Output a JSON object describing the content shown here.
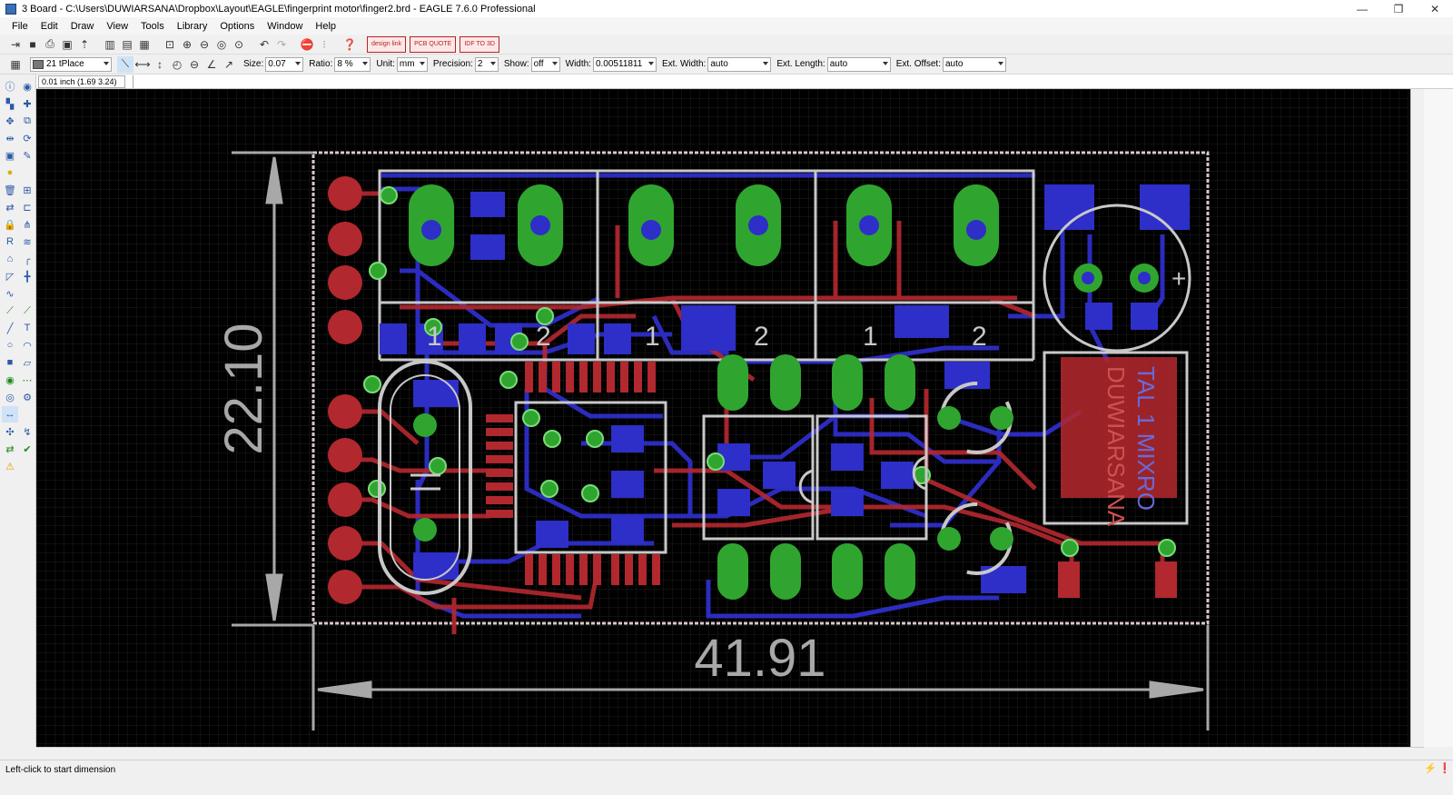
{
  "window": {
    "title": "3 Board - C:\\Users\\DUWIARSANA\\Dropbox\\Layout\\EAGLE\\fingerprint motor\\finger2.brd - EAGLE 7.6.0 Professional",
    "minimize": "—",
    "maximize": "❐",
    "close": "✕"
  },
  "menu": [
    "File",
    "Edit",
    "Draw",
    "View",
    "Tools",
    "Library",
    "Options",
    "Window",
    "Help"
  ],
  "promo": {
    "design_link": "design link",
    "pcb_quote": "PCB QUOTE",
    "idf": "IDF TO 3D"
  },
  "params": {
    "layer": "21 tPlace",
    "size_label": "Size:",
    "size": "0.07",
    "ratio_label": "Ratio:",
    "ratio": "8 %",
    "unit_label": "Unit:",
    "unit": "mm",
    "precision_label": "Precision:",
    "precision": "2",
    "show_label": "Show:",
    "show": "off",
    "width_label": "Width:",
    "width": "0.00511811",
    "ext_width_label": "Ext. Width:",
    "ext_width": "auto",
    "ext_length_label": "Ext. Length:",
    "ext_length": "auto",
    "ext_offset_label": "Ext. Offset:",
    "ext_offset": "auto"
  },
  "coord_readout": "0.01 inch (1.69 3.24)",
  "command_value": "",
  "board": {
    "dim_height": "22.10",
    "dim_width": "41.91",
    "label_1a": "1",
    "label_2a": "2",
    "label_1b": "1",
    "label_2b": "2",
    "label_1c": "1",
    "label_2c": "2",
    "plus": "+",
    "mirror_text_1": "DUWIARSANA",
    "mirror_text_2": "TAL 1 MIXRO"
  },
  "status": {
    "message": "Left-click to start dimension"
  },
  "colors": {
    "top_copper": "#b1282e",
    "bottom_copper": "#2e2ec8",
    "pads": "#2fa52f",
    "silk": "#c8c8c8",
    "background": "#000000"
  }
}
